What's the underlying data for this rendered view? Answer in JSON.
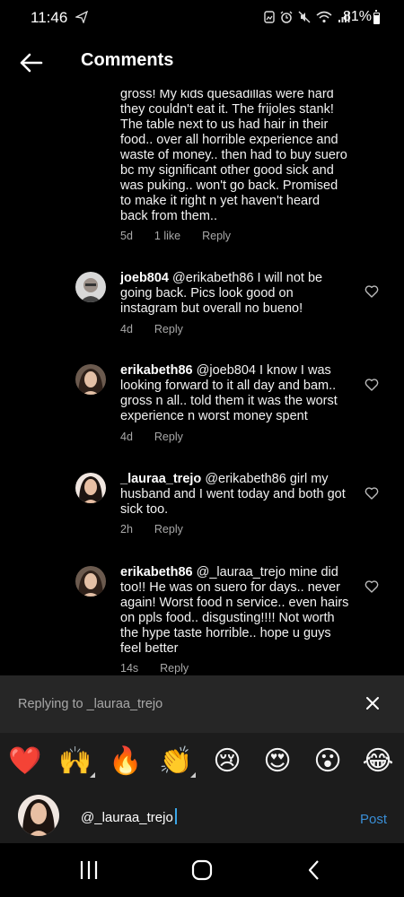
{
  "status_bar": {
    "time": "11:46",
    "battery": "81%",
    "icons": [
      "paper-plane-icon",
      "image-notification-icon",
      "alarm-icon",
      "mute-icon",
      "wifi-icon",
      "signal-icon",
      "battery-icon"
    ]
  },
  "header": {
    "title": "Comments"
  },
  "comments": [
    {
      "user": "",
      "text": "gross! My kids quesadillas were hard they couldn't eat it. The frijoles stank! The table next to us had hair in their food.. over all horrible experience and waste of money.. then had to buy suero bc my significant other good sick and was puking.. won't go back. Promised to make it right n yet haven't heard back from them..",
      "time": "5d",
      "likes": "1 like",
      "reply": "Reply"
    },
    {
      "user": "joeb804",
      "text": "@erikabeth86 I will not be going back. Pics look good on instagram but overall no bueno!",
      "time": "4d",
      "likes": "",
      "reply": "Reply"
    },
    {
      "user": "erikabeth86",
      "text": "@joeb804 I know I was looking forward to it all day and bam.. gross n all.. told them it was the worst experience n worst money spent",
      "time": "4d",
      "likes": "",
      "reply": "Reply"
    },
    {
      "user": "_lauraa_trejo",
      "text": "@erikabeth86 girl my husband and I went today and both got sick too.",
      "time": "2h",
      "likes": "",
      "reply": "Reply"
    },
    {
      "user": "erikabeth86",
      "text": "@_lauraa_trejo mine did too!! He was on suero for days.. never again! Worst food n service.. even hairs on ppls food.. disgusting!!!! Not worth the hype taste horrible.. hope u guys feel better",
      "time": "14s",
      "likes": "",
      "reply": "Reply"
    }
  ],
  "reply_bar": {
    "text": "Replying to _lauraa_trejo"
  },
  "emojis": [
    "❤️",
    "🙌",
    "🔥",
    "👏",
    "😢",
    "😍",
    "😮",
    "😂"
  ],
  "input": {
    "value": "@_lauraa_trejo",
    "post_label": "Post"
  },
  "nav": [
    "recent-apps-icon",
    "home-icon",
    "back-icon"
  ]
}
